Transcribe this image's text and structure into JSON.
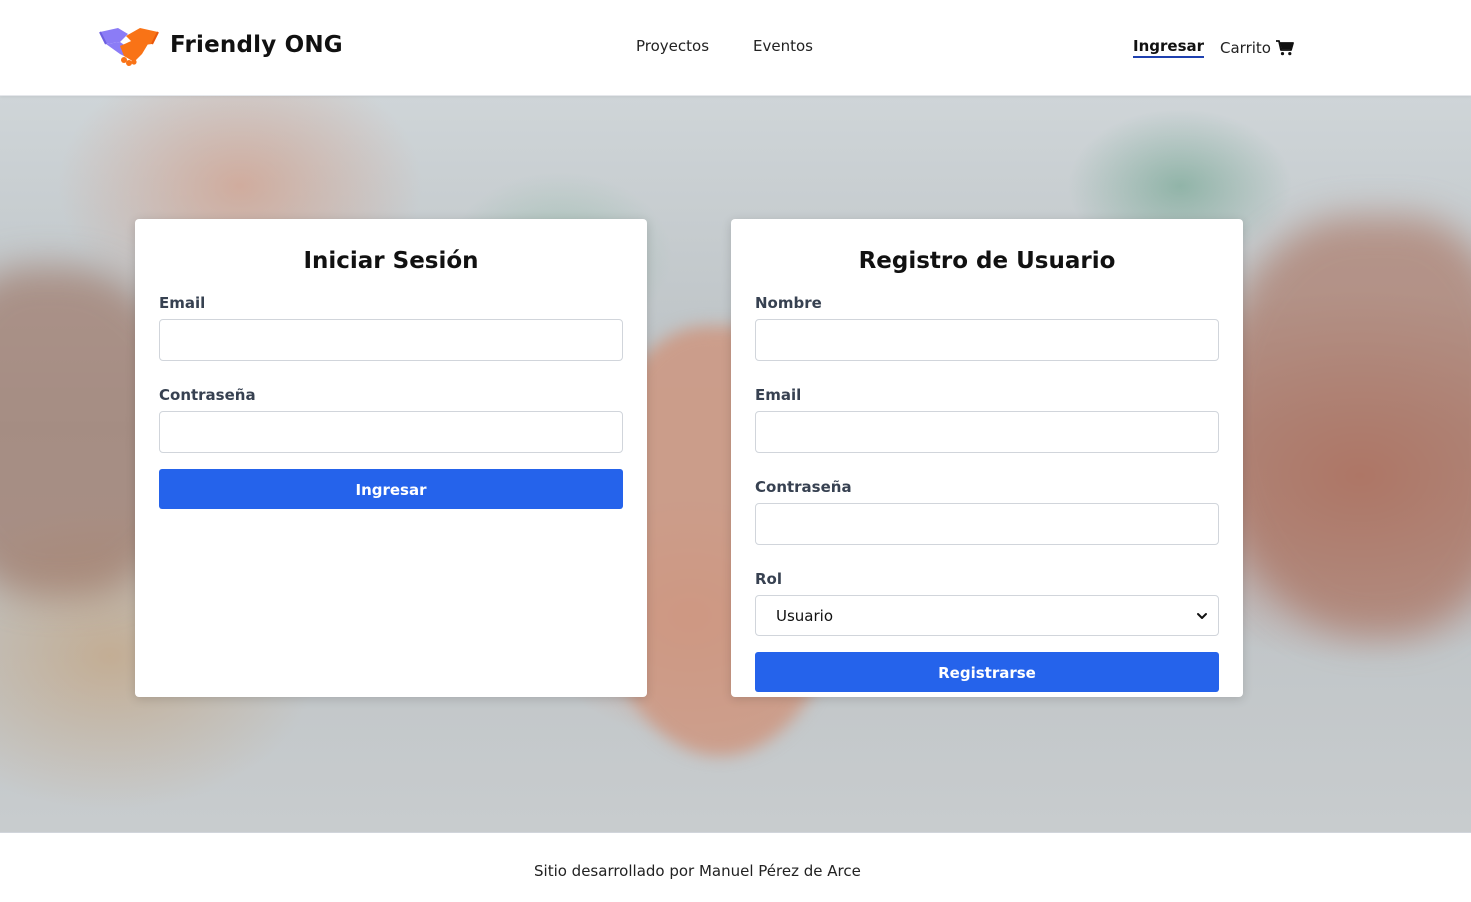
{
  "header": {
    "brand": "Friendly ONG",
    "nav": [
      "Proyectos",
      "Eventos"
    ],
    "login": "Ingresar",
    "cart": "Carrito",
    "logo_icon": "handshake-icon",
    "cart_icon": "shopping-cart-icon"
  },
  "login_card": {
    "title": "Iniciar Sesión",
    "email_label": "Email",
    "email_value": "",
    "password_label": "Contraseña",
    "password_value": "",
    "submit": "Ingresar"
  },
  "register_card": {
    "title": "Registro de Usuario",
    "name_label": "Nombre",
    "name_value": "",
    "email_label": "Email",
    "email_value": "",
    "password_label": "Contraseña",
    "password_value": "",
    "role_label": "Rol",
    "role_selected": "Usuario",
    "submit": "Registrarse"
  },
  "footer": {
    "text": "Sitio desarrollado por Manuel Pérez de Arce"
  },
  "colors": {
    "primary_button": "#2563eb",
    "active_underline": "#1e40af",
    "logo_purple": "#8b7cf6",
    "logo_orange": "#f97316"
  }
}
